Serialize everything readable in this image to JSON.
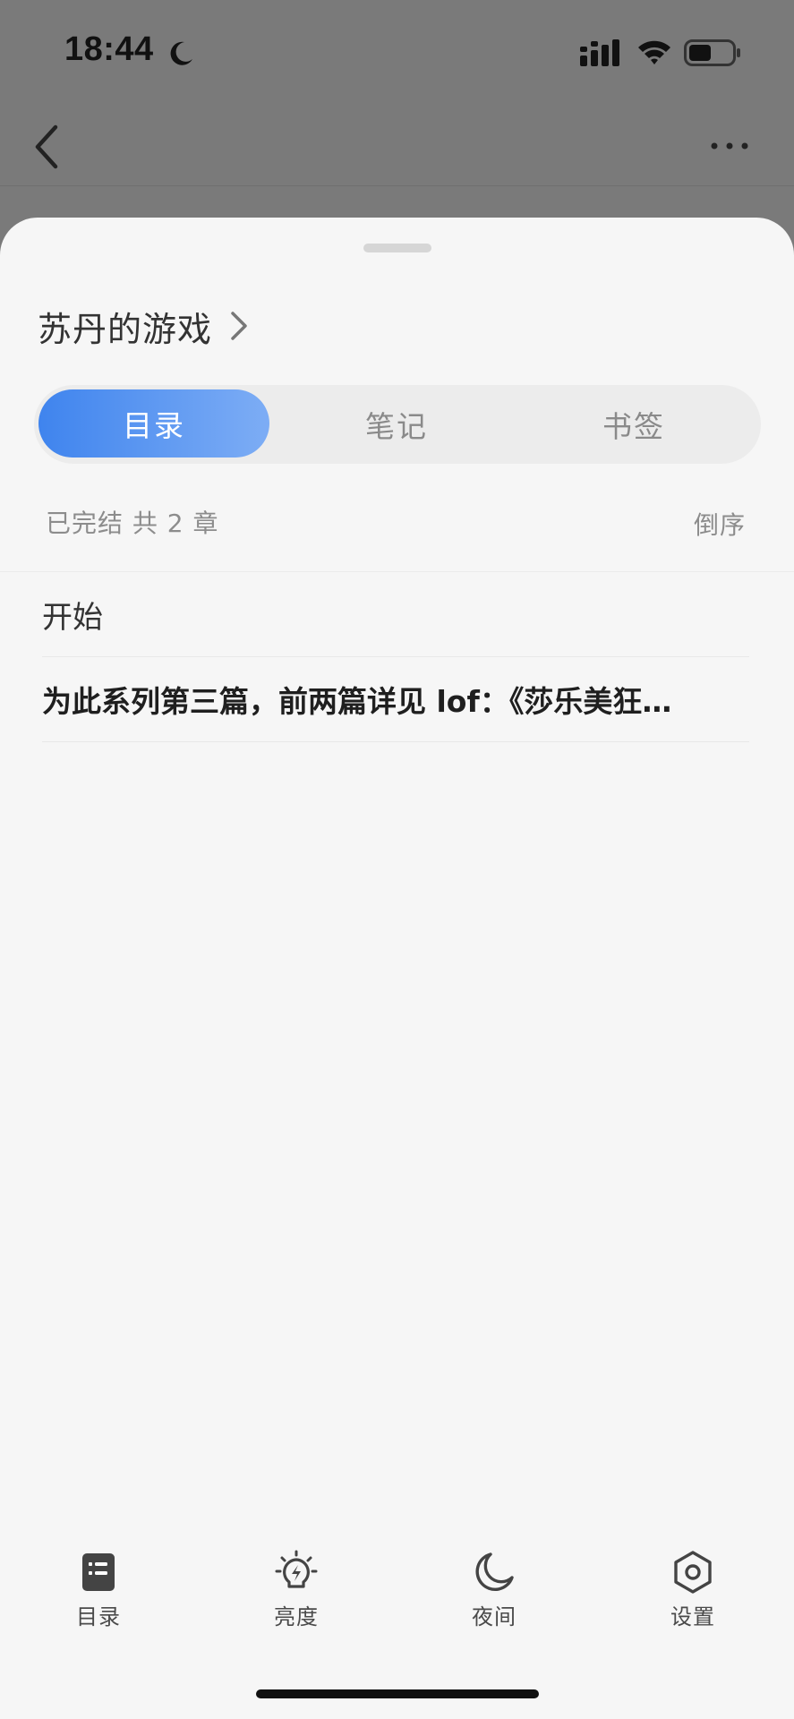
{
  "status_bar": {
    "time": "18:44"
  },
  "sheet": {
    "book_title": "苏丹的游戏",
    "tabs": [
      {
        "label": "目录",
        "active": true
      },
      {
        "label": "笔记",
        "active": false
      },
      {
        "label": "书签",
        "active": false
      }
    ],
    "meta": {
      "status_text": "已完结 共 2 章",
      "sort_label": "倒序"
    },
    "chapters": [
      {
        "title": "开始",
        "bold": false
      },
      {
        "title": "为此系列第三篇，前两篇详见 lof：《莎乐美狂…",
        "bold": true
      }
    ]
  },
  "toolbar": {
    "items": [
      {
        "label": "目录",
        "icon": "toc-icon"
      },
      {
        "label": "亮度",
        "icon": "brightness-icon"
      },
      {
        "label": "夜间",
        "icon": "night-mode-icon"
      },
      {
        "label": "设置",
        "icon": "settings-icon"
      }
    ]
  },
  "colors": {
    "accent_start": "#3f84ee",
    "accent_end": "#7dadf5",
    "backdrop": "#7a7a7a",
    "sheet_bg": "#f6f6f6"
  }
}
